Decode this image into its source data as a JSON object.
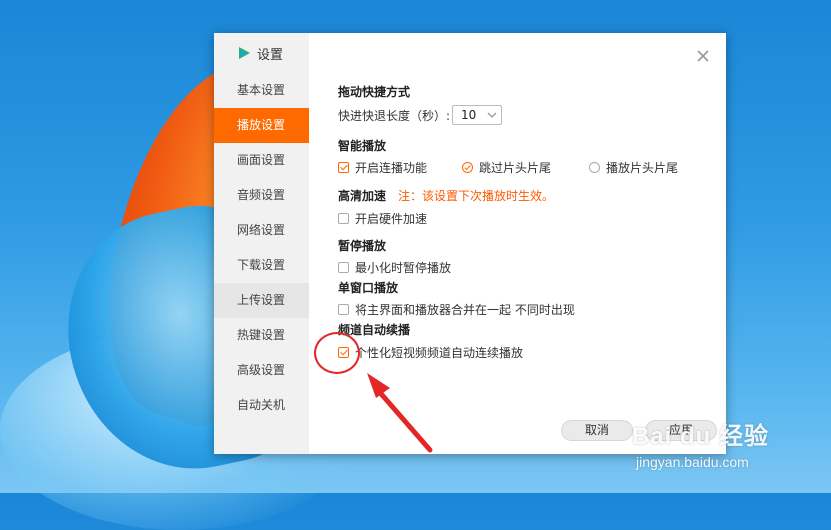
{
  "dialog": {
    "title": "设置",
    "nav": [
      {
        "label": "基本设置",
        "state": "normal"
      },
      {
        "label": "播放设置",
        "state": "active"
      },
      {
        "label": "画面设置",
        "state": "normal"
      },
      {
        "label": "音频设置",
        "state": "normal"
      },
      {
        "label": "网络设置",
        "state": "normal"
      },
      {
        "label": "下载设置",
        "state": "normal"
      },
      {
        "label": "上传设置",
        "state": "hover"
      },
      {
        "label": "热键设置",
        "state": "normal"
      },
      {
        "label": "高级设置",
        "state": "normal"
      },
      {
        "label": "自动关机",
        "state": "normal"
      }
    ],
    "sections": {
      "drag": {
        "title": "拖动快捷方式",
        "label": "快进快退长度（秒）:",
        "value": "10"
      },
      "smart": {
        "title": "智能播放",
        "continuous": "开启连播功能",
        "skip": "跳过片头片尾",
        "play": "播放片头片尾"
      },
      "hw": {
        "title": "高清加速",
        "note": "注：该设置下次播放时生效。",
        "option": "开启硬件加速"
      },
      "pause": {
        "title": "暂停播放",
        "option": "最小化时暂停播放"
      },
      "single": {
        "title": "单窗口播放",
        "option": "将主界面和播放器合并在一起 不同时出现"
      },
      "channel": {
        "title": "频道自动续播",
        "option": "个性化短视频频道自动连续播放"
      }
    },
    "buttons": {
      "cancel": "取消",
      "apply": "应用"
    }
  },
  "watermark": {
    "logo": "Bai du 经验",
    "url": "jingyan.baidu.com"
  },
  "colors": {
    "accent": "#ff6a00",
    "note": "#ff5a00",
    "annotation": "#e32626"
  }
}
